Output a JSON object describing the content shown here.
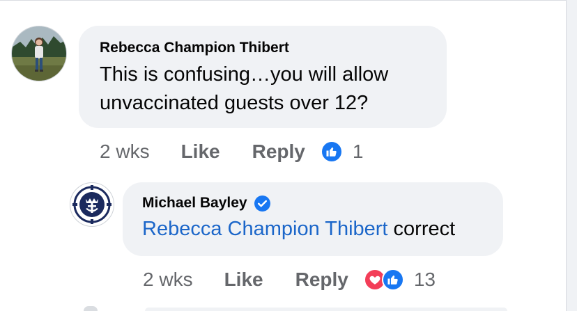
{
  "comments": [
    {
      "author": "Rebecca Champion Thibert",
      "text_line1": "This is confusing…you will allow",
      "text_line2": "unvaccinated guests over 12?",
      "time": "2 wks",
      "like_label": "Like",
      "reply_label": "Reply",
      "reaction_icons": [
        "like-icon"
      ],
      "reaction_count": "1"
    },
    {
      "author": "Michael Bayley",
      "verified": true,
      "mention": "Rebecca Champion Thibert",
      "text": " correct",
      "time": "2 wks",
      "like_label": "Like",
      "reply_label": "Reply",
      "reaction_icons": [
        "love-icon",
        "like-icon"
      ],
      "reaction_count": "13"
    }
  ],
  "colors": {
    "bubble": "#f0f2f5",
    "mention": "#1b66c9",
    "like": "#1877f2",
    "love": "#f33e58",
    "meta": "#65676b"
  }
}
